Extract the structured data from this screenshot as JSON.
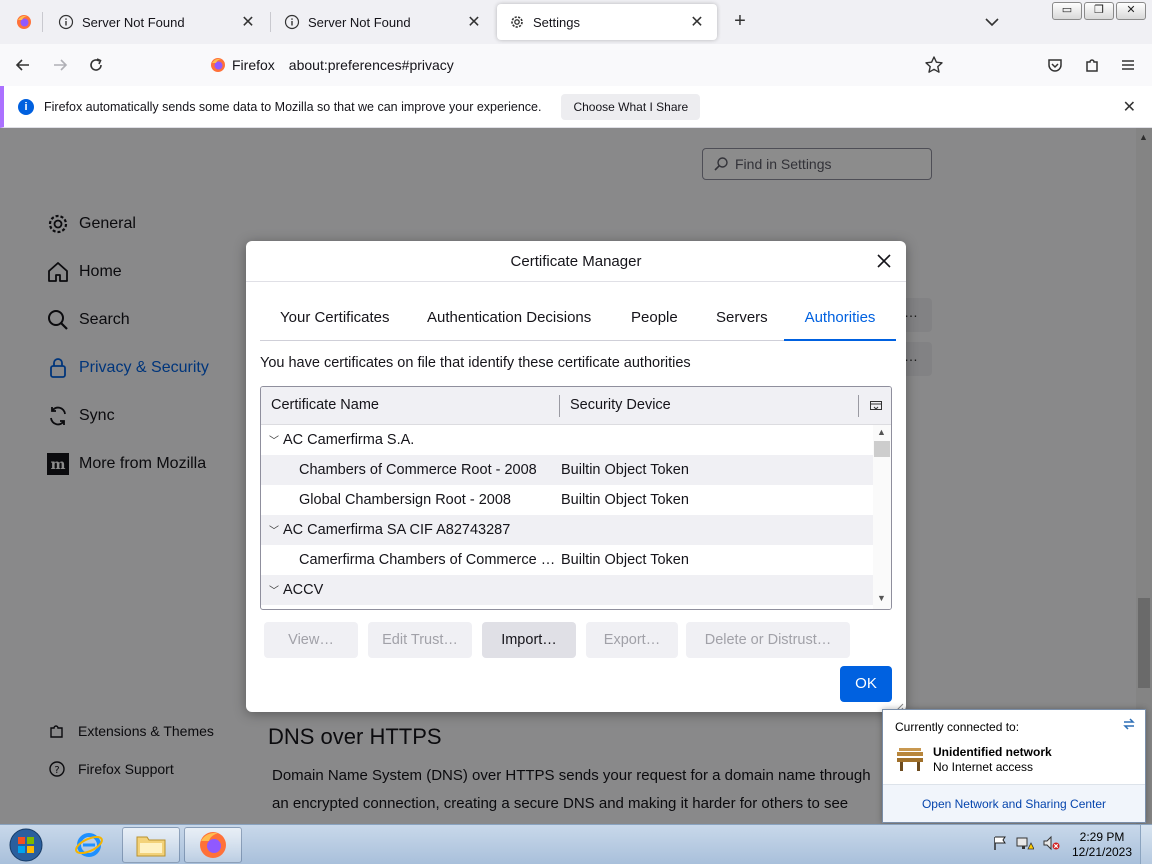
{
  "tabs": [
    {
      "label": "Server Not Found",
      "icon": "info-icon"
    },
    {
      "label": "Server Not Found",
      "icon": "info-icon"
    },
    {
      "label": "Settings",
      "icon": "gear-icon"
    }
  ],
  "window_controls": {
    "minimize": "▭",
    "restore": "❐",
    "close": "✕"
  },
  "urlbar": {
    "identity_label": "Firefox",
    "url": "about:preferences#privacy"
  },
  "notification": {
    "text": "Firefox automatically sends some data to Mozilla so that we can improve your experience.",
    "button_label": "Choose What I Share"
  },
  "settings": {
    "find_placeholder": "Find in Settings",
    "categories": [
      {
        "label": "General",
        "icon": "gear-icon"
      },
      {
        "label": "Home",
        "icon": "home-icon"
      },
      {
        "label": "Search",
        "icon": "search-icon"
      },
      {
        "label": "Privacy & Security",
        "icon": "lock-icon",
        "selected": true
      },
      {
        "label": "Sync",
        "icon": "sync-icon"
      },
      {
        "label": "More from Mozilla",
        "icon": "mozilla-icon"
      }
    ],
    "footer": [
      {
        "label": "Extensions & Themes",
        "icon": "puzzle-icon"
      },
      {
        "label": "Firefox Support",
        "icon": "help-icon"
      }
    ],
    "dns_title": "DNS over HTTPS",
    "dns_text": "Domain Name System (DNS) over HTTPS sends your request for a domain name through an encrypted connection, creating a secure DNS and making it harder for others to see which"
  },
  "dialog": {
    "title": "Certificate Manager",
    "tabs": [
      "Your Certificates",
      "Authentication Decisions",
      "People",
      "Servers",
      "Authorities"
    ],
    "active_tab": "Authorities",
    "intro": "You have certificates on file that identify these certificate authorities",
    "columns": [
      "Certificate Name",
      "Security Device"
    ],
    "rows": [
      {
        "type": "group",
        "name": "AC Camerfirma S.A.",
        "device": ""
      },
      {
        "type": "item",
        "name": "Chambers of Commerce Root - 2008",
        "device": "Builtin Object Token"
      },
      {
        "type": "item",
        "name": "Global Chambersign Root - 2008",
        "device": "Builtin Object Token"
      },
      {
        "type": "group",
        "name": "AC Camerfirma SA CIF A82743287",
        "device": ""
      },
      {
        "type": "item",
        "name": "Camerfirma Chambers of Commerce Root",
        "device": "Builtin Object Token"
      },
      {
        "type": "group",
        "name": "ACCV",
        "device": ""
      }
    ],
    "buttons": {
      "view": "View…",
      "edit_trust": "Edit Trust…",
      "import": "Import…",
      "export": "Export…",
      "delete": "Delete or Distrust…"
    },
    "ok_label": "OK"
  },
  "network_popup": {
    "header": "Currently connected to:",
    "network_name": "Unidentified network",
    "status": "No Internet access",
    "link": "Open Network and Sharing Center"
  },
  "taskbar": {
    "time": "2:29 PM",
    "date": "12/21/2023"
  },
  "colors": {
    "accent": "#0061e0",
    "notification_border": "#ab71ff",
    "ok_button": "#0061e0"
  }
}
